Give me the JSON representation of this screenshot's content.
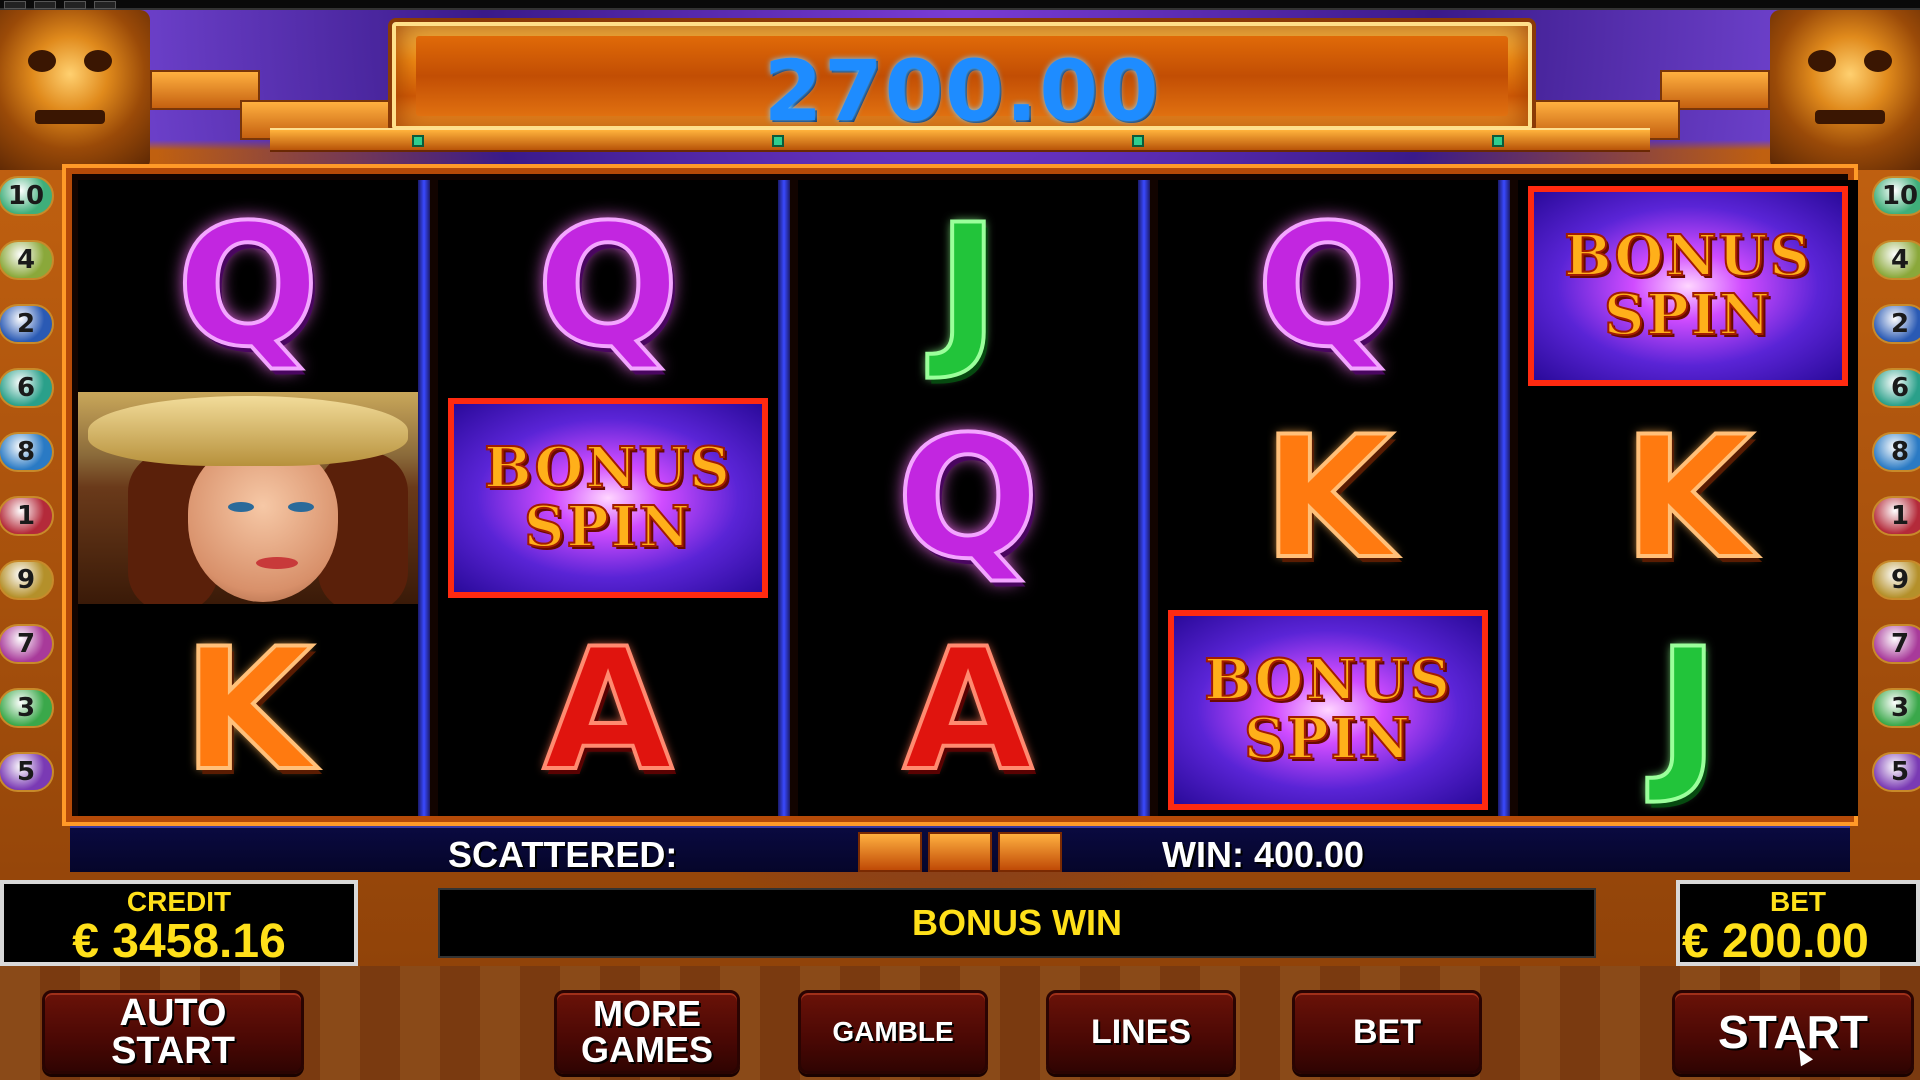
{
  "jackpot": {
    "amount": "2700.00"
  },
  "reels": [
    [
      "Q",
      "WOMAN",
      "K"
    ],
    [
      "Q",
      "BONUS_SPIN",
      "A"
    ],
    [
      "J",
      "Q",
      "A"
    ],
    [
      "Q",
      "K",
      "BONUS_SPIN"
    ],
    [
      "BONUS_SPIN",
      "K",
      "J"
    ]
  ],
  "bonus_symbol": {
    "line1": "BONUS",
    "line2": "SPIN"
  },
  "line_numbers": [
    "10",
    "4",
    "2",
    "6",
    "8",
    "1",
    "9",
    "7",
    "3",
    "5"
  ],
  "line_colors": [
    "#3fae7a",
    "#8aa83a",
    "#2a5ab4",
    "#2aa08a",
    "#2a7ac4",
    "#b42a3a",
    "#b4902a",
    "#a83a9a",
    "#3aa84a",
    "#7a3ab4"
  ],
  "strip": {
    "scattered_label": "SCATTERED:",
    "win_text": "WIN: 400.00"
  },
  "credit": {
    "label": "CREDIT",
    "value": "€ 3458.16"
  },
  "bet": {
    "label": "BET",
    "value": "€ 200.00"
  },
  "message": "BONUS WIN",
  "buttons": {
    "auto_start_1": "AUTO",
    "auto_start_2": "START",
    "more_games_1": "MORE",
    "more_games_2": "GAMES",
    "gamble": "GAMBLE",
    "lines": "LINES",
    "bet": "BET",
    "start": "START"
  },
  "colors": {
    "jackpot_text": "#1e8cff",
    "panel_text": "#ffe01a",
    "button_bg": "#4a0804"
  }
}
